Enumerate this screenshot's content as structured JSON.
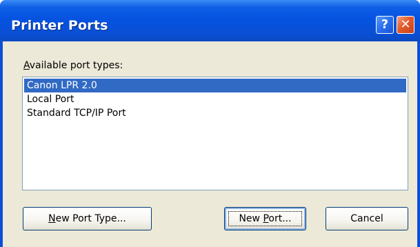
{
  "window": {
    "title": "Printer Ports",
    "help_icon": "help-icon",
    "close_icon": "close-icon"
  },
  "label": {
    "prefix": "",
    "accel": "A",
    "rest": "vailable port types:"
  },
  "ports": {
    "items": [
      {
        "label": "Canon LPR 2.0",
        "selected": true
      },
      {
        "label": "Local Port",
        "selected": false
      },
      {
        "label": "Standard TCP/IP Port",
        "selected": false
      }
    ]
  },
  "buttons": {
    "new_port_type": {
      "prefix": "",
      "accel": "N",
      "rest": "ew Port Type..."
    },
    "new_port": {
      "prefix": "New ",
      "accel": "P",
      "rest": "ort..."
    },
    "cancel": "Cancel"
  },
  "colors": {
    "title_bar": "#0553e0",
    "selection": "#316ac5",
    "dialog_bg": "#ece9d8"
  }
}
